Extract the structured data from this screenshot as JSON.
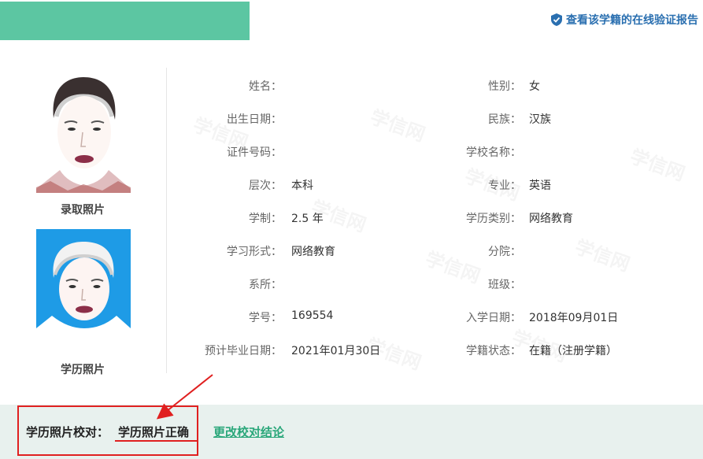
{
  "header": {
    "verify_link": "查看该学籍的在线验证报告"
  },
  "photos": {
    "admission_label": "录取照片",
    "degree_label": "学历照片"
  },
  "watermark_text": "学信网",
  "fields": [
    {
      "l_label": "姓名：",
      "l_value": "",
      "r_label": "性别：",
      "r_value": "女"
    },
    {
      "l_label": "出生日期：",
      "l_value": "",
      "r_label": "民族：",
      "r_value": "汉族"
    },
    {
      "l_label": "证件号码：",
      "l_value": "",
      "r_label": "学校名称：",
      "r_value": ""
    },
    {
      "l_label": "层次：",
      "l_value": "本科",
      "r_label": "专业：",
      "r_value": "英语"
    },
    {
      "l_label": "学制：",
      "l_value": "2.5 年",
      "r_label": "学历类别：",
      "r_value": "网络教育"
    },
    {
      "l_label": "学习形式：",
      "l_value": "网络教育",
      "r_label": "分院：",
      "r_value": ""
    },
    {
      "l_label": "系所：",
      "l_value": "",
      "r_label": "班级：",
      "r_value": ""
    },
    {
      "l_label": "学号：",
      "l_value": "169554",
      "r_label": "入学日期：",
      "r_value": "2018年09月01日"
    },
    {
      "l_label": "预计毕业日期：",
      "l_value": "2021年01月30日",
      "r_label": "学籍状态：",
      "r_value": "在籍（注册学籍）"
    }
  ],
  "check": {
    "label": "学历照片校对：",
    "value": "学历照片正确",
    "change_link": "更改校对结论"
  },
  "colors": {
    "green": "#5cc6a2",
    "link_blue": "#2a6fb0",
    "link_green": "#2aa77a",
    "annotation_red": "#e02020",
    "photo_blue": "#1e9be6"
  }
}
